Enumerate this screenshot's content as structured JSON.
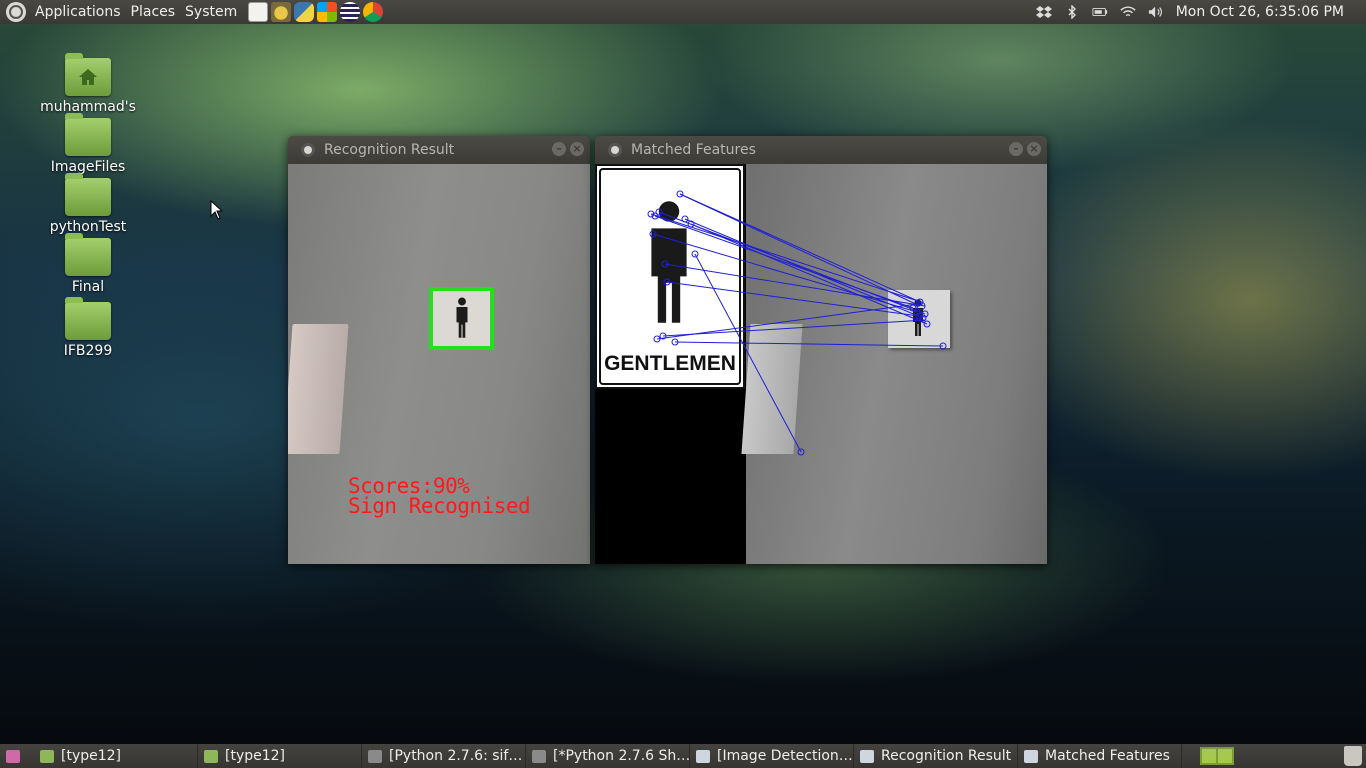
{
  "top_panel": {
    "menus": [
      "Applications",
      "Places",
      "System"
    ],
    "launchers": [
      "text-editor-icon",
      "gimp-icon",
      "python-icon",
      "windows-icon",
      "eclipse-icon",
      "chrome-icon"
    ],
    "tray": [
      "dropbox-icon",
      "bluetooth-icon",
      "battery-icon",
      "wifi-icon",
      "volume-icon"
    ],
    "clock": "Mon Oct 26,  6:35:06 PM"
  },
  "desktop_icons": [
    {
      "label": "muhammad's Home",
      "icon": "home-folder-icon"
    },
    {
      "label": "ImageFiles",
      "icon": "folder-icon"
    },
    {
      "label": "pythonTest",
      "icon": "folder-icon"
    },
    {
      "label": "Final",
      "icon": "folder-icon"
    },
    {
      "label": "IFB299",
      "icon": "folder-icon"
    }
  ],
  "windows": {
    "recognition": {
      "title": "Recognition Result",
      "score_text": "Scores:90%",
      "status_text": "Sign Recognised"
    },
    "matched": {
      "title": "Matched Features",
      "sign_text": "GENTLEMEN"
    }
  },
  "taskbar": {
    "items": [
      {
        "label": "[type12]",
        "icon": "folder-icon"
      },
      {
        "label": "[type12]",
        "icon": "folder-icon"
      },
      {
        "label": "[Python 2.7.6: sif…",
        "icon": "python-shell-icon"
      },
      {
        "label": "[*Python 2.7.6 Sh…",
        "icon": "python-shell-icon"
      },
      {
        "label": "[Image Detection…",
        "icon": "window-icon"
      },
      {
        "label": "Recognition Result",
        "icon": "window-icon"
      },
      {
        "label": "Matched Features",
        "icon": "window-icon"
      }
    ]
  },
  "colors": {
    "match_lines": "#1f1fd6",
    "detection_box": "#22e01a",
    "score_text": "#ff1a1a"
  }
}
